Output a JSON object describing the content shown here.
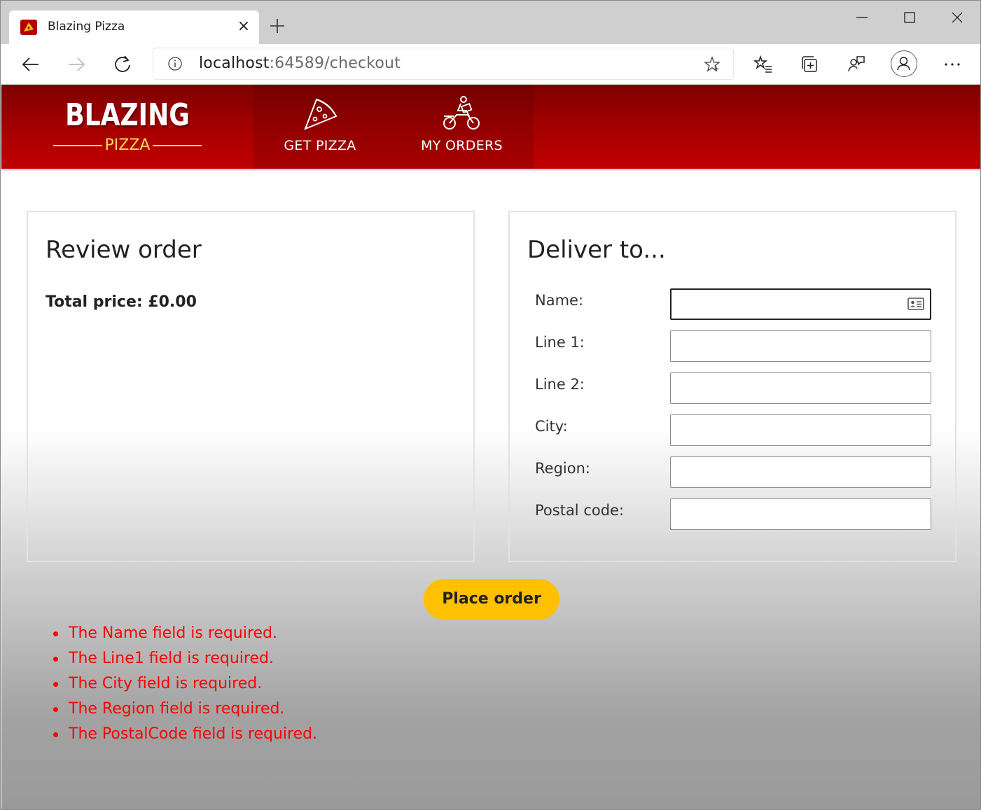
{
  "browser": {
    "tab_title": "Blazing Pizza",
    "url_host": "localhost",
    "url_rest": ":64589/checkout"
  },
  "app": {
    "logo_title": "BLAZING",
    "logo_subtitle": "PIZZA",
    "nav": [
      {
        "label": "GET PIZZA",
        "icon": "pizza-slice-icon"
      },
      {
        "label": "MY ORDERS",
        "icon": "motorbike-delivery-icon"
      }
    ],
    "brand_color": "#c10000",
    "accent_color": "#ffc000"
  },
  "review": {
    "heading": "Review order",
    "total_text": "Total price: £0.00"
  },
  "delivery": {
    "heading": "Deliver to...",
    "fields": [
      {
        "label": "Name:",
        "value": ""
      },
      {
        "label": "Line 1:",
        "value": ""
      },
      {
        "label": "Line 2:",
        "value": ""
      },
      {
        "label": "City:",
        "value": ""
      },
      {
        "label": "Region:",
        "value": ""
      },
      {
        "label": "Postal code:",
        "value": ""
      }
    ]
  },
  "actions": {
    "place_order_label": "Place order"
  },
  "validation": {
    "error_color": "#ff0000",
    "errors": [
      "The Name field is required.",
      "The Line1 field is required.",
      "The City field is required.",
      "The Region field is required.",
      "The PostalCode field is required."
    ]
  }
}
